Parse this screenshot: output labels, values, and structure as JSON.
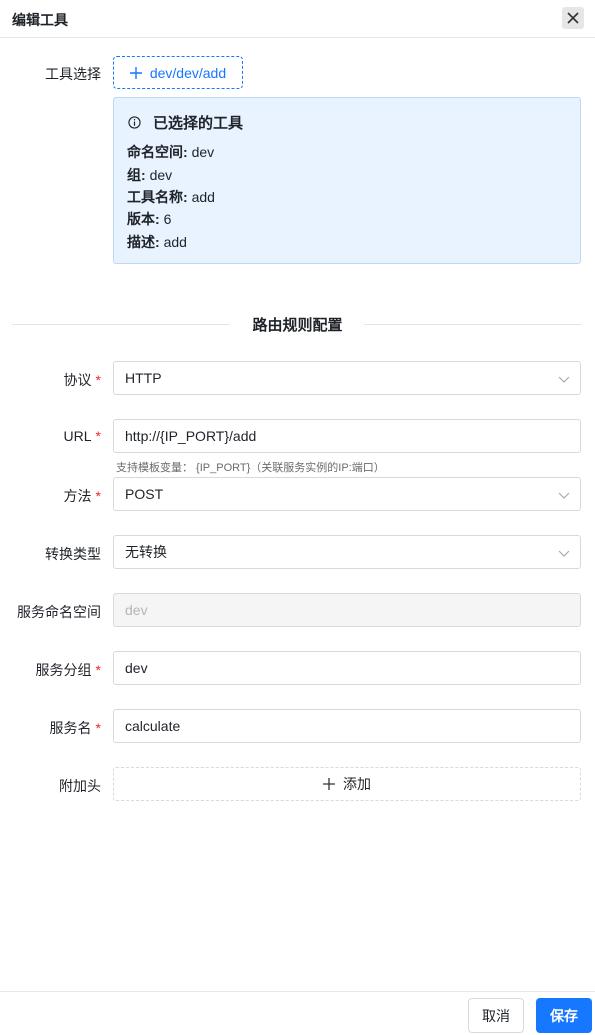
{
  "dialog": {
    "title": "编辑工具"
  },
  "tool_select": {
    "label": "工具选择",
    "button_label": "dev/dev/add"
  },
  "selected_tool": {
    "heading": "已选择的工具",
    "namespace_label": "命名空间:",
    "namespace_value": "dev",
    "group_label": "组:",
    "group_value": "dev",
    "name_label": "工具名称:",
    "name_value": "add",
    "version_label": "版本:",
    "version_value": "6",
    "desc_label": "描述:",
    "desc_value": "add"
  },
  "section": {
    "title": "路由规则配置"
  },
  "form": {
    "protocol": {
      "label": "协议",
      "value": "HTTP"
    },
    "url": {
      "label": "URL",
      "value": "http://{IP_PORT}/add",
      "hint": "支持模板变量： {IP_PORT}（关联服务实例的IP:端口）"
    },
    "method": {
      "label": "方法",
      "value": "POST"
    },
    "transform": {
      "label": "转换类型",
      "value": "无转换"
    },
    "service_namespace": {
      "label": "服务命名空间",
      "value": "dev"
    },
    "service_group": {
      "label": "服务分组",
      "value": "dev"
    },
    "service_name": {
      "label": "服务名",
      "value": "calculate"
    },
    "headers": {
      "label": "附加头",
      "add_label": "添加"
    }
  },
  "footer": {
    "cancel_label": "取消",
    "save_label": "保存"
  },
  "colors": {
    "primary": "#1677ff",
    "required": "#f5222d",
    "info_bg": "#e8f3ff"
  },
  "icons": {
    "close": "close-icon",
    "plus": "plus-icon",
    "info": "info-icon",
    "chevron": "chevron-down-icon"
  }
}
